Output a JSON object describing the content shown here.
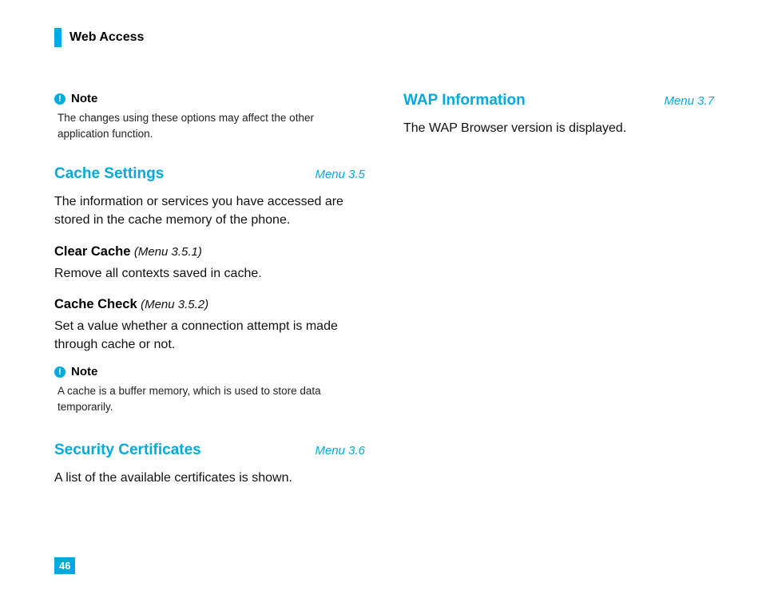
{
  "chapter": "Web Access",
  "page_number": "46",
  "left": {
    "note1": {
      "label": "Note",
      "text": "The changes using these options may affect the other application function."
    },
    "cache_settings": {
      "title": "Cache Settings",
      "menu": "Menu 3.5",
      "intro": "The information or services you have accessed are stored in the cache memory of the phone.",
      "sub1": {
        "title": "Clear Cache",
        "menu": "(Menu 3.5.1)",
        "text": "Remove all contexts saved in cache."
      },
      "sub2": {
        "title": "Cache Check",
        "menu": "(Menu 3.5.2)",
        "text": "Set a value whether a connection attempt is made through cache or not."
      }
    },
    "note2": {
      "label": "Note",
      "text": "A cache is a buffer memory, which is used to store data temporarily."
    },
    "security": {
      "title": "Security Certificates",
      "menu": "Menu 3.6",
      "text": "A list of the available certificates is shown."
    }
  },
  "right": {
    "wap": {
      "title": "WAP Information",
      "menu": "Menu 3.7",
      "text": "The WAP Browser version is displayed."
    }
  }
}
